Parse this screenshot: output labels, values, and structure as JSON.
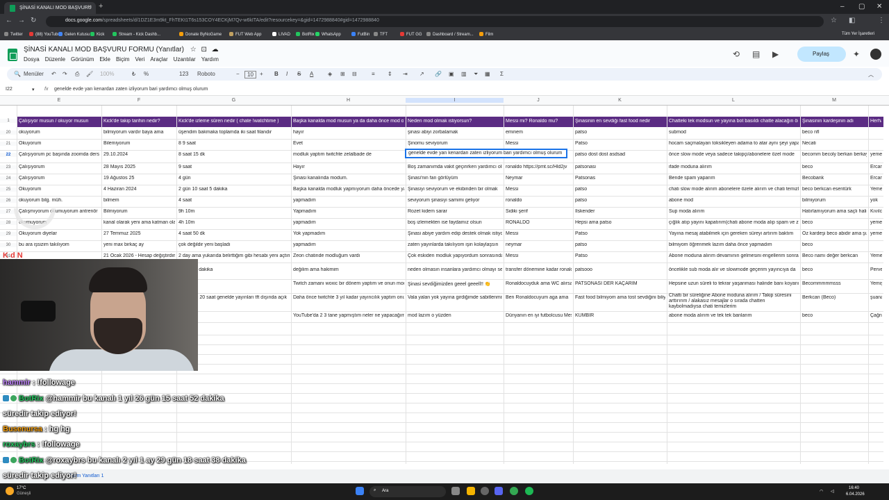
{
  "browser": {
    "tab_title": "ŞİNASİ KANALI MOD BAŞVURU",
    "url_domain": "docs.google.com",
    "url_path": "/spreadsheets/d/1DZ1E3m9kt_FhTEKt1T6s153COY4ECKjM7Qv-w6kITA/edit?resourcekey=&gid=1472988840#gid=1472988840",
    "bookmarks": [
      "Twitter",
      "(88) YouTube",
      "Gelen Kutusu",
      "Kick",
      "Stream - Kick Dashb...",
      "Donate ByNoGame",
      "FUT Web App",
      "LIVAD",
      "BotRix",
      "WhatsApp",
      "FutBin",
      "TFT",
      "FUT GG",
      "Dashboard / Stream...",
      "Film"
    ],
    "all_bookmarks": "Tüm Yer İşaretleri"
  },
  "doc": {
    "title": "ŞİNASİ KANALI MOD BAŞVURU FORMU (Yanıtlar)",
    "menu": [
      "Dosya",
      "Düzenle",
      "Görünüm",
      "Ekle",
      "Biçim",
      "Veri",
      "Araçlar",
      "Uzantılar",
      "Yardım"
    ],
    "share_label": "Paylaş"
  },
  "toolbar": {
    "menus_label": "Menüler",
    "zoom": "100%",
    "currency": "₺",
    "percent": "%",
    "num_format": "123",
    "font": "Roboto",
    "font_size": "10"
  },
  "formula_bar": {
    "cell_ref": "I22",
    "fx": "fx",
    "content": "genelde evde yan kenardan zaten izliyorum bari yardımcı olmuş olurum"
  },
  "columns": [
    "E",
    "F",
    "G",
    "H",
    "I",
    "J",
    "K",
    "L",
    "M"
  ],
  "header_row": {
    "num": "1",
    "cells": [
      "Çalışıyor musun / okuyor musun",
      "Kick'de takip tarihin nedir?",
      "Kick'de izleme süren nedir ( chate !watchtime )",
      "Başka kanalda mod musun ya da daha önce mod oldun mu?",
      "Neden mod olmak istiyorsun?",
      "Messi mi? Ronaldo mu?",
      "Şinasinin en sevdiği fast food nedir",
      "Chatteki tek modsun ve yayına bot basıldı chatte alacağın önlem",
      "Şinasinin kardeşinin adı",
      "Herhangi"
    ]
  },
  "rows": [
    {
      "num": "20",
      "cells": [
        "okuyorum",
        "bilmiyorum vardır baya ama",
        "üşendim bakmaka toplamda iki saat filandır",
        "hayır",
        "şinasi abiyi zorbalamak",
        "eminem",
        "patso",
        "submod",
        "beco nfl",
        ""
      ]
    },
    {
      "num": "21",
      "cells": [
        "Okuyorum",
        "Bilemiyorum",
        "8 9 saat",
        "Evet",
        "Şinomu seviyorum",
        "Messi",
        "Patso",
        "hocam saçmalayan toksikleyen adama to atar aynı şeyi yapan",
        "Necati",
        ""
      ]
    },
    {
      "num": "22",
      "cells": [
        "Çalışıyorum pc başında zoomda ders",
        "29.10.2024",
        "8 saat 15 dk",
        "modluk yaptım twitchte zelalbade de",
        "",
        "",
        "patso dost dost asdsad",
        "önce slow mode veya sadece takipçi/abonelere özel mode",
        "becomm becoly berkan berkay",
        "yemeci"
      ]
    },
    {
      "num": "23",
      "cells": [
        "Çalışıyorum",
        "28 Mayıs 2025",
        "9 saat",
        "Hayır",
        "Boş zamanımda vakit geçirirken yardımcı olmak",
        "ronaldo https://pmt.sc/Hld2jv",
        "patsonasi",
        "ifade moduna alırım",
        "beco",
        "Ercan"
      ]
    },
    {
      "num": "24",
      "cells": [
        "Çalışıyorum",
        "19 Ağustos 25",
        "4 gün",
        "Şinasi kanalında modum.",
        "Şinasi'nin fan görlüyüm",
        "Neymar",
        "Patsonas",
        "Bende spam yaparım",
        "Becobank",
        "Ercan"
      ]
    },
    {
      "num": "25",
      "cells": [
        "Okuyorum",
        "4 Haziran 2024",
        "2 gün 10 saat 5 dakika",
        "Başka kanalda modluk yapmıyorum daha öncede yapmadım",
        "Şinasiyi seviyorum ve ekibinden bir olmak",
        "Messi",
        "patso",
        "chati slow mode alırım abonelere özele alırım ve chati temizlerim",
        "beco berkcan esentürk",
        "Yemeci"
      ]
    },
    {
      "num": "26",
      "cells": [
        "okuyorum bilg. müh.",
        "bilmem",
        "4 saat",
        "yapmadım",
        "seviyorum şinasiyi samimi geliyor",
        "ronaldo",
        "patso",
        "abone mod",
        "bilmiyorum",
        "yok"
      ]
    },
    {
      "num": "27",
      "cells": [
        "Çalışmıyorum okumuyorum antrenör",
        "Bilmiyorum",
        "9h 10m",
        "Yapmadım",
        "Rozet kidem sarar",
        "Sidiki şerif",
        "İlskender",
        "Sup moda alırım",
        "Hatırlamıyorum ama saçlı hali Beko",
        "Kıvılcım"
      ]
    },
    {
      "num": "28",
      "cells": [
        "okumuyorum",
        "kanal olarak yeni ama katman olarak",
        "4h 10m",
        "yapmadım",
        "boş izlemekten ise faydamız olsun",
        "RONALDO",
        "Hepsi ama patso",
        "çığlık atıp yayını kapatırım(chati abone moda alıp spam ve zararlı mesajları siler)",
        "beco",
        "yemeci"
      ]
    },
    {
      "num": "29",
      "cells": [
        "Okuyorum diyelar",
        "27 Temmuz 2025",
        "4 saat 50 dk",
        "Yok yapmadım",
        "Şinasi abiye yardım edip destek olmak istiyorum",
        "Messi",
        "Patso",
        "Yayına mesaj atabilmek için gereken süreyi artırım baktım",
        "Öz kardeşi beco abidir ama şu an",
        "yemeci"
      ]
    },
    {
      "num": "30",
      "cells": [
        "bu ara işsizim takılıyom",
        "yeni max birkaç ay",
        "çok değildir yeni başladı",
        "yapmadım",
        "zaten yayınlarda takılıyom işin kolaylaşsın",
        "neymar",
        "patso",
        "bilmiyom öğrenmek lazım daha önce yapmadım",
        "beco",
        ""
      ]
    },
    {
      "num": "31",
      "cells": [
        "",
        "21 Ocak 2026 - Hesap değiştirdim",
        "2 day ama yukarıda belirttiğim gibi hesabi yeni açtım",
        "Zeon chatinde modluğum vardı",
        "Çok eskiden modluk yapıyordum sonrasında bıraktım",
        "Messi",
        "Patso",
        "Abone moduna alırım devamının gelmesini engellerim sonra",
        "Beco namı değer berkcan",
        "Yemeci"
      ]
    },
    {
      "num": "32",
      "cells": [
        "",
        "",
        "1 gün 20 dakika",
        "değilim ama hakimim",
        "neden olmasın insanlara yardımcı olmayı severim",
        "transfer dönemine kadar ronaldo",
        "patsooo",
        "öncelikle sub moda alır ve slowmode geçerim yayıncıya da",
        "beco",
        "Perverli"
      ]
    },
    {
      "num": "33",
      "cells": [
        "",
        "",
        "yakın",
        "Twitch zamanı woxic bir dönem yaptım ve onun mod ekibindeyim",
        "Şinasi sevdiğimizden geeel geeell!! 👏",
        "Ronaldocuyduk ama WC alırsa messi",
        "PATSONASİ DER KAÇARIM",
        "Hepsine uzun süreli to tekrar yaşanması halinde banı koyarım",
        "Becommmmmsss",
        "Yemiş"
      ]
    },
    {
      "num": "34",
      "cells": [
        "",
        "",
        "ak chatte 20 saat genelde yayınları tft dışında açık",
        "Daha önce twitchte 3 yıl kadar yayıncılık yaptım onun dışında",
        "Vala yalan yok yayına girdiğimde sabitlenmiş mesaj",
        "Ben Ronaldocuyum aga ama",
        "Fast food bilmiyom ama tost sevdiğini biliyom",
        "Chatti bir süreliğine Abone moduna alırım / Takip süresini arttırırım / alakasız mesajlar o sırada chatten kaybolmadıysa chati temizlerim",
        "Berkcan (Beco)",
        "şuana"
      ]
    },
    {
      "num": "35",
      "cells": [
        "",
        "",
        "5 dk",
        "YouTube'da 2 3 tane yapmıştım neler ne yapacağımı biliyorum",
        "mod lazım o yüzden",
        "Dünyanın en iyi futbolcusu Messi",
        "KUMBİR",
        "abone moda alırım ve tek tek banlarım",
        "beco",
        "Çağn a"
      ]
    }
  ],
  "selected_cell_text": "genelde evde yan kenardan zaten izliyorum bari yardımcı olmuş olurum",
  "overlay_text": {
    "kdn": "K d  N",
    "cloud": "DUBAI"
  },
  "chat": [
    {
      "user": "hammir",
      "msg": ": !followage",
      "color": "#c084fc"
    },
    {
      "user": "BotRix",
      "msg": "@hammir bu kanalı 1 yıl 26 gün 15 saat 52 dakika",
      "color": "#22c55e",
      "mention": "@hammir"
    },
    {
      "user": "",
      "msg": "süredir takip ediyor!",
      "color": "#fff"
    },
    {
      "user": "Busenursa",
      "msg": ": hg hg",
      "color": "#f59e0b"
    },
    {
      "user": "roxaybrs",
      "msg": ": !followage",
      "color": "#22c55e"
    },
    {
      "user": "BotRix",
      "msg": "@roxaybrs bu kanalı 2 yıl 1 ay 29 gün 18 saat 38 dakika",
      "color": "#22c55e"
    },
    {
      "user": "",
      "msg": "süredir takip ediyor!",
      "color": "#fff"
    }
  ],
  "sheet_tab": "Form Yanıtları 1",
  "taskbar": {
    "weather_temp": "17°C",
    "weather_desc": "Güneşli",
    "search": "Ara",
    "time": "16:40",
    "date": "6.04.2026"
  },
  "colors": {
    "header_purple": "#5b2c83",
    "select_blue": "#1a73e8",
    "share_bg": "#c2e7ff"
  }
}
